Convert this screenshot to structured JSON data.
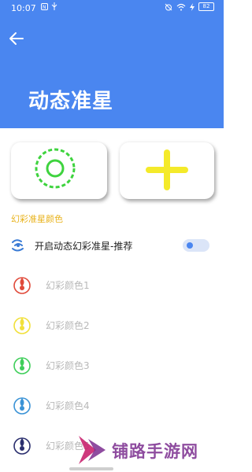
{
  "status_bar": {
    "time": "10:07",
    "battery": "82"
  },
  "header": {
    "title": "动态准星",
    "color": "#4a86f0"
  },
  "cards": [
    {
      "name": "preview-crosshair",
      "color": "#3ed33e"
    },
    {
      "name": "add-crosshair",
      "color": "#f4ea2a"
    }
  ],
  "section": {
    "title": "幻彩准星颜色",
    "enable_label": "开启动态幻彩准星-推荐",
    "enable_on": true
  },
  "colors": [
    {
      "label": "幻彩颜色1",
      "color": "#e04a3a"
    },
    {
      "label": "幻彩颜色2",
      "color": "#f1e03a"
    },
    {
      "label": "幻彩颜色3",
      "color": "#3fce5a"
    },
    {
      "label": "幻彩颜色4",
      "color": "#3b93d6"
    },
    {
      "label": "幻彩颜色5",
      "color": "#2b2f6e"
    }
  ],
  "watermark": {
    "text": "铺路手游网"
  }
}
